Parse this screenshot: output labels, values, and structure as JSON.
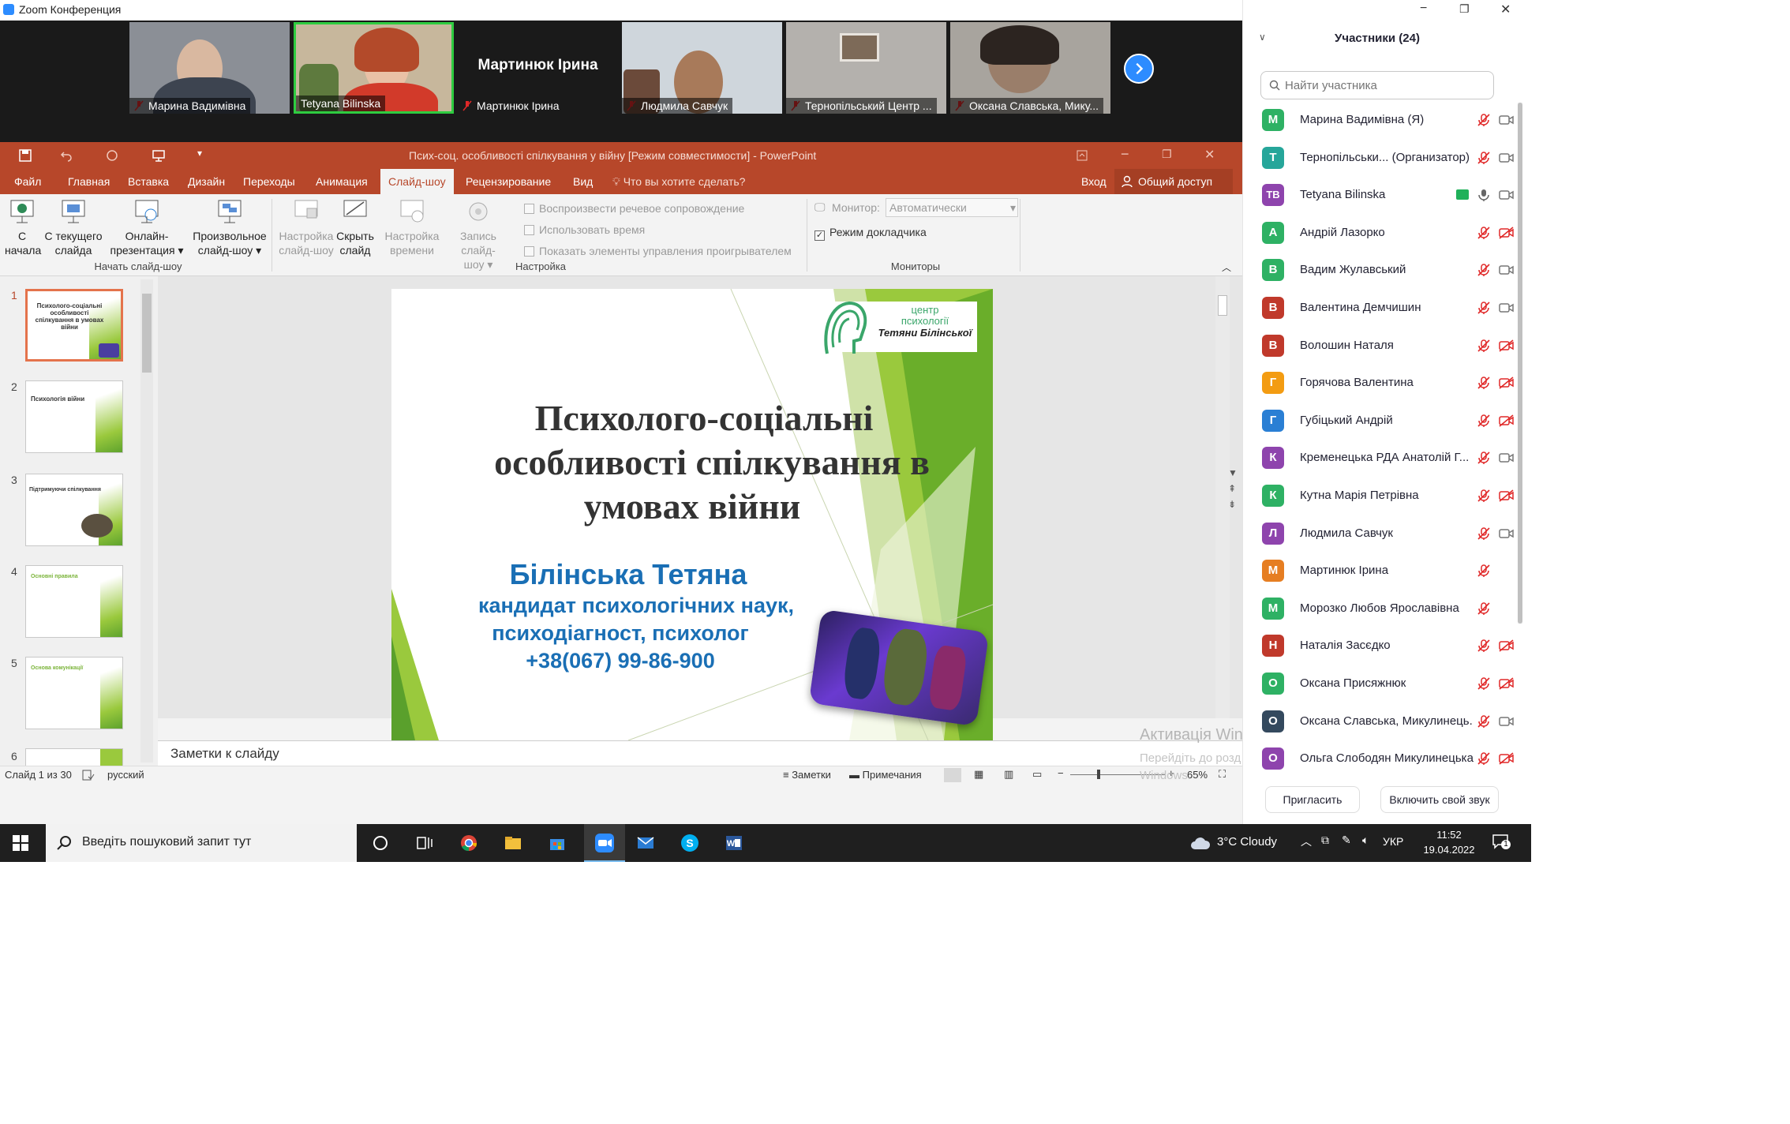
{
  "zoom": {
    "window_title": "Zoom Конференция",
    "video_tiles": [
      {
        "name": "Марина Вадимівна",
        "kind": "video"
      },
      {
        "name": "Tetyana Bilinska",
        "kind": "video",
        "active": true
      },
      {
        "name": "Мартинюк Ірина",
        "kind": "name-only",
        "big_name": "Мартинюк Ірина"
      },
      {
        "name": "Людмила Савчук",
        "kind": "video"
      },
      {
        "name": "Тернопільський Центр ...",
        "kind": "video"
      },
      {
        "name": "Оксана Славська, Мику...",
        "kind": "video"
      }
    ],
    "next_icon": "chevron-right-icon"
  },
  "ppt": {
    "title": "Псих-соц. особливості спілкування у війну [Режим совместимости] - PowerPoint",
    "tabs": [
      "Файл",
      "Главная",
      "Вставка",
      "Дизайн",
      "Переходы",
      "Анимация",
      "Слайд-шоу",
      "Рецензирование",
      "Вид"
    ],
    "active_tab": "Слайд-шоу",
    "tell_me": "Что вы хотите сделать?",
    "signin": "Вход",
    "share": "Общий доступ",
    "ribbon": {
      "start_from_beginning": [
        "С",
        "начала"
      ],
      "from_current": [
        "С текущего",
        "слайда"
      ],
      "online": [
        "Онлайн-",
        "презентация"
      ],
      "custom": [
        "Произвольное",
        "слайд-шоу"
      ],
      "group_start": "Начать слайд-шоу",
      "setup": [
        "Настройка",
        "слайд-шоу"
      ],
      "hide": [
        "Скрыть",
        "слайд"
      ],
      "rehearse": [
        "Настройка",
        "времени"
      ],
      "record": [
        "Запись слайд-",
        "шоу"
      ],
      "chk_narration": "Воспроизвести речевое сопровождение",
      "chk_timings": "Использовать время",
      "chk_controls": "Показать элементы управления проигрывателем",
      "group_setup": "Настройка",
      "monitor_label": "Монитор:",
      "monitor_value": "Автоматически",
      "presenter_view": "Режим докладчика",
      "group_monitors": "Мониторы"
    },
    "slide_numbers": [
      "1",
      "2",
      "3",
      "4",
      "5",
      "6"
    ],
    "thumb_texts": [
      "Психолого-соціальні особливості спілкування в умовах війни",
      "Психологія війни",
      "Підтримуючи спілкування",
      "Основні правила",
      "Основа комунікації",
      ""
    ],
    "slide": {
      "title_lines": [
        "Психолого-соціальні",
        "особливості спілкування в",
        "умовах війни"
      ],
      "author": "Білінська Тетяна",
      "degree": "кандидат психологічних наук,",
      "role": "психодіагност, психолог",
      "phone": "+38(067) 99-86-900",
      "logo_line1": "центр",
      "logo_line2": "психології",
      "logo_line3": "Тетяни Білінської"
    },
    "notes_placeholder": "Заметки к слайду",
    "status": {
      "slide_of": "Слайд 1 из 30",
      "language": "русский",
      "notes_btn": "Заметки",
      "comments_btn": "Примечания",
      "zoom": "65%"
    },
    "watermark_title": "Активація Windows",
    "watermark_sub": "Перейдіть до розд",
    "watermark_sub2": "Windows."
  },
  "participants": {
    "header": "Участники (24)",
    "search_placeholder": "Найти участника",
    "invite": "Пригласить",
    "unmute_self": "Включить свой звук",
    "list": [
      {
        "initials": "М",
        "name": "Марина Вадимівна (Я)",
        "color": "#2eb164",
        "mic": "muted",
        "cam": "on"
      },
      {
        "initials": "Т",
        "name": "Тернопільськи... (Организатор)",
        "color": "#26a69a",
        "mic": "muted",
        "cam": "on"
      },
      {
        "initials": "TB",
        "name": "Tetyana Bilinska",
        "color": "#8e44ad",
        "mic": "on",
        "cam": "on",
        "share": true
      },
      {
        "initials": "А",
        "name": "Андрій Лазорко",
        "color": "#2eb164",
        "mic": "muted",
        "cam": "off"
      },
      {
        "initials": "В",
        "name": "Вадим Жулавський",
        "color": "#2eb164",
        "mic": "muted",
        "cam": "on"
      },
      {
        "initials": "В",
        "name": "Валентина Демчишин",
        "color": "#c0392b",
        "mic": "muted",
        "cam": "on"
      },
      {
        "initials": "В",
        "name": "Волошин Наталя",
        "color": "#c0392b",
        "mic": "muted",
        "cam": "off"
      },
      {
        "initials": "Г",
        "name": "Горячова Валентина",
        "color": "#f39c12",
        "mic": "muted",
        "cam": "off"
      },
      {
        "initials": "Г",
        "name": "Губіцький Андрій",
        "color": "#2a7fd4",
        "mic": "muted",
        "cam": "off"
      },
      {
        "initials": "К",
        "name": "Кременецька РДА Анатолій Г...",
        "color": "#8e44ad",
        "mic": "muted",
        "cam": "on"
      },
      {
        "initials": "К",
        "name": "Кутна Марія Петрівна",
        "color": "#2eb164",
        "mic": "muted",
        "cam": "off"
      },
      {
        "initials": "Л",
        "name": "Людмила Савчук",
        "color": "#8e44ad",
        "mic": "muted",
        "cam": "on"
      },
      {
        "initials": "М",
        "name": "Мартинюк Ірина",
        "color": "#e67e22",
        "mic": "muted",
        "cam": "none"
      },
      {
        "initials": "М",
        "name": "Морозко Любов Ярославівна",
        "color": "#2eb164",
        "mic": "muted",
        "cam": "none"
      },
      {
        "initials": "Н",
        "name": "Наталія Засєдко",
        "color": "#c0392b",
        "mic": "muted",
        "cam": "off"
      },
      {
        "initials": "О",
        "name": "Оксана Присяжнюк",
        "color": "#2eb164",
        "mic": "muted",
        "cam": "off"
      },
      {
        "initials": "О",
        "name": "Оксана Славська, Микулинець...",
        "color": "#34495e",
        "mic": "muted",
        "cam": "on"
      },
      {
        "initials": "О",
        "name": "Ольга Слободян Микулинецька се...",
        "color": "#8e44ad",
        "mic": "muted",
        "cam": "off"
      }
    ]
  },
  "taskbar": {
    "search_placeholder": "Введіть пошуковий запит тут",
    "weather": "3°C  Cloudy",
    "language": "УКР",
    "time": "11:52",
    "date": "19.04.2022",
    "notifications": "1"
  }
}
